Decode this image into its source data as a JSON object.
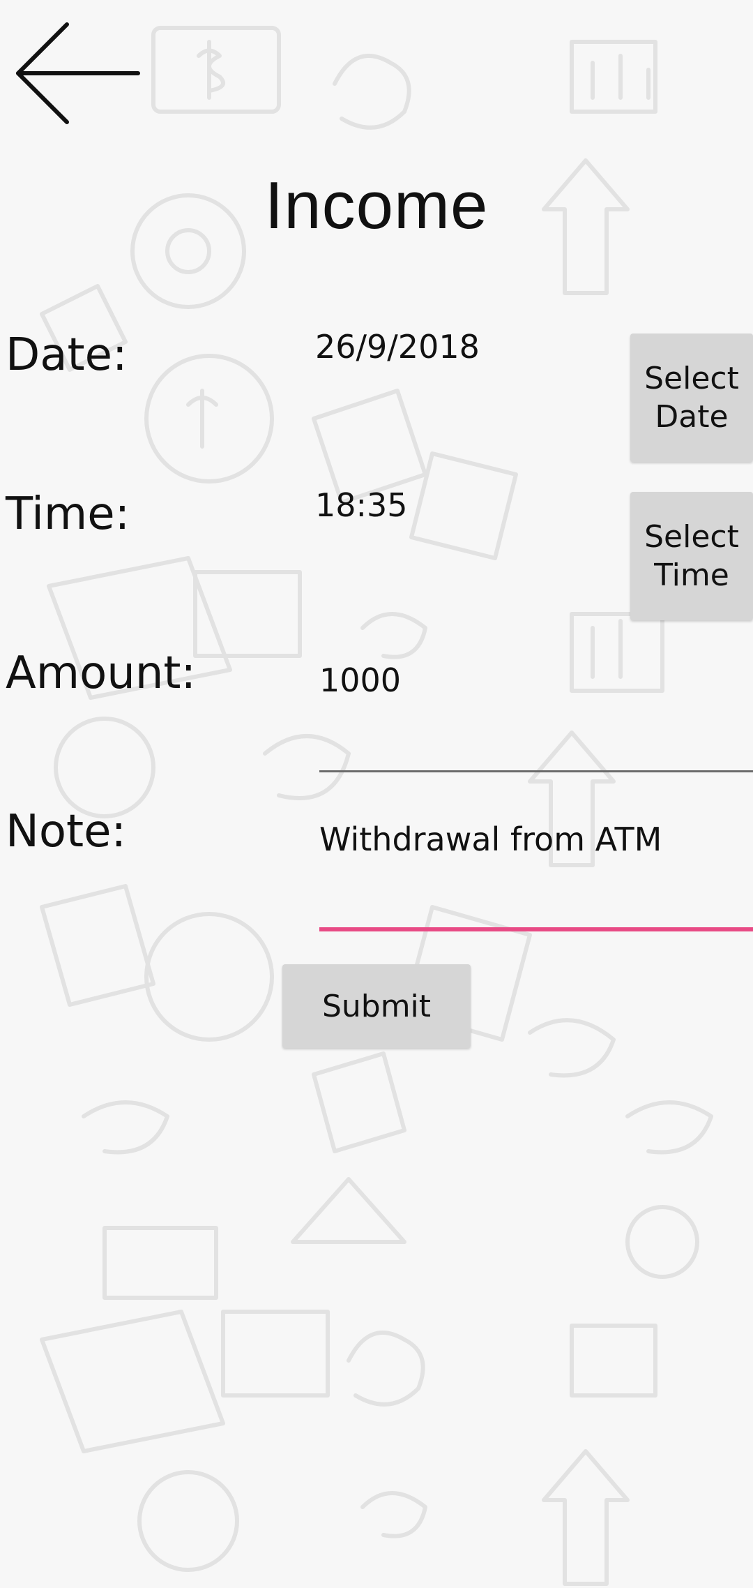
{
  "header": {
    "back_icon": "arrow-left-icon",
    "title": "Income"
  },
  "form": {
    "date": {
      "label": "Date:",
      "value": "26/9/2018",
      "button_label": "Select Date"
    },
    "time": {
      "label": "Time:",
      "value": "18:35",
      "button_label": "Select Time"
    },
    "amount": {
      "label": "Amount:",
      "value": "1000"
    },
    "note": {
      "label": "Note:",
      "value": "Withdrawal from ATM"
    },
    "submit_label": "Submit"
  },
  "colors": {
    "background": "#f7f7f7",
    "button_gray": "#d6d6d6",
    "active_underline": "#e84a85",
    "inactive_underline": "#6b6b6b"
  }
}
